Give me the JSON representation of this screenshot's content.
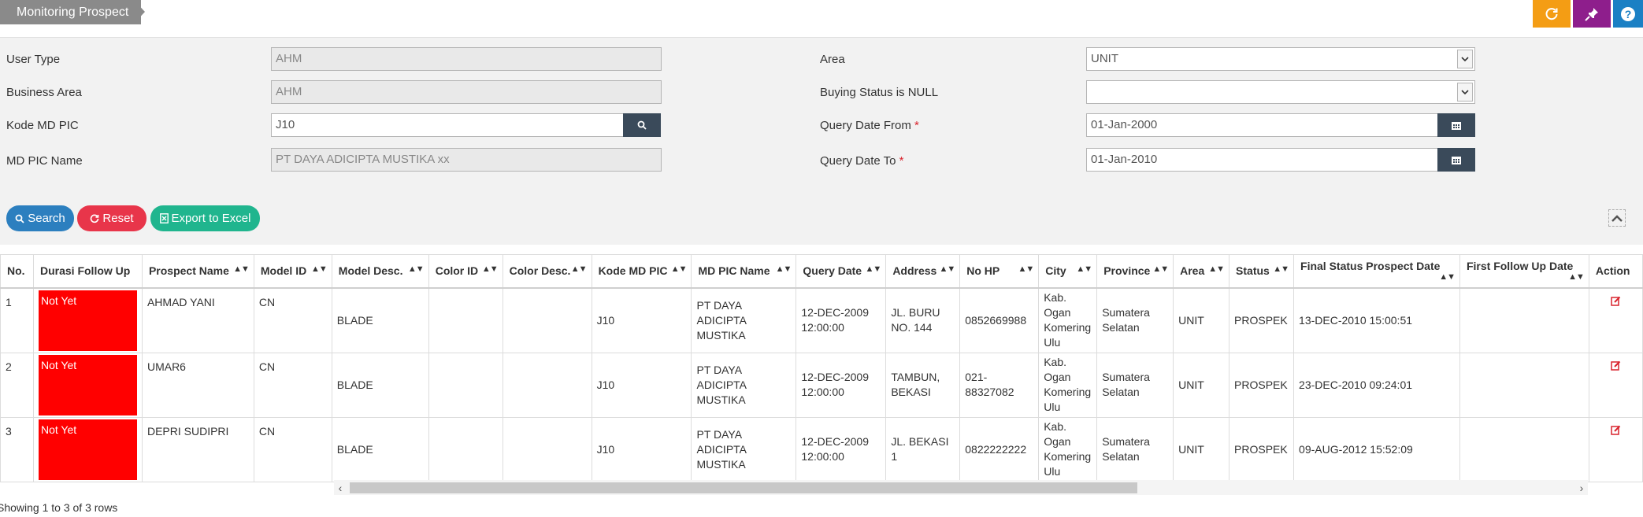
{
  "header": {
    "title": "Monitoring Prospect",
    "icons": [
      "refresh-icon",
      "pin-icon",
      "help-icon"
    ]
  },
  "form": {
    "user_type": {
      "label": "User Type",
      "value": "AHM"
    },
    "business_area": {
      "label": "Business Area",
      "value": "AHM"
    },
    "kode_md_pic": {
      "label": "Kode MD PIC",
      "value": "J10"
    },
    "md_pic_name": {
      "label": "MD PIC Name",
      "value": "PT DAYA ADICIPTA MUSTIKA xx"
    },
    "area": {
      "label": "Area",
      "value": "UNIT"
    },
    "buying_status": {
      "label": "Buying Status is NULL",
      "value": ""
    },
    "query_date_from": {
      "label": "Query Date From",
      "value": "01-Jan-2000"
    },
    "query_date_to": {
      "label": "Query Date To",
      "value": "01-Jan-2010"
    },
    "required_mark": "*"
  },
  "actions": {
    "search": "Search",
    "reset": "Reset",
    "export": "Export to Excel"
  },
  "table": {
    "columns": [
      "No.",
      "Durasi Follow Up",
      "Prospect Name",
      "Model ID",
      "Model Desc.",
      "Color ID",
      "Color Desc.",
      "Kode MD PIC",
      "MD PIC Name",
      "Query Date",
      "Address",
      "No HP",
      "City",
      "Province",
      "Area",
      "Status",
      "Final Status Prospect Date",
      "First Follow Up Date",
      "Action"
    ],
    "rows": [
      {
        "no": "1",
        "durasi": "Not Yet",
        "prospect": "AHMAD YANI",
        "model_id": "CN",
        "model_desc": "BLADE",
        "color_id": "",
        "color_desc": "",
        "kode": "J10",
        "pic_name": "PT DAYA ADICIPTA MUSTIKA",
        "query_date": "12-DEC-2009 12:00:00",
        "address": "JL. BURU NO. 144",
        "no_hp": "0852669988",
        "city": "Kab. Ogan Komering Ulu",
        "province": "Sumatera Selatan",
        "area": "UNIT",
        "status": "PROSPEK",
        "final_date": "13-DEC-2010 15:00:51",
        "first_date": ""
      },
      {
        "no": "2",
        "durasi": "Not Yet",
        "prospect": "UMAR6",
        "model_id": "CN",
        "model_desc": "BLADE",
        "color_id": "",
        "color_desc": "",
        "kode": "J10",
        "pic_name": "PT DAYA ADICIPTA MUSTIKA",
        "query_date": "12-DEC-2009 12:00:00",
        "address": "TAMBUN, BEKASI",
        "no_hp": "021-88327082",
        "city": "Kab. Ogan Komering Ulu",
        "province": "Sumatera Selatan",
        "area": "UNIT",
        "status": "PROSPEK",
        "final_date": "23-DEC-2010 09:24:01",
        "first_date": ""
      },
      {
        "no": "3",
        "durasi": "Not Yet",
        "prospect": "DEPRI SUDIPRI",
        "model_id": "CN",
        "model_desc": "BLADE",
        "color_id": "",
        "color_desc": "",
        "kode": "J10",
        "pic_name": "PT DAYA ADICIPTA MUSTIKA",
        "query_date": "12-DEC-2009 12:00:00",
        "address": "JL. BEKASI 1",
        "no_hp": "0822222222",
        "city": "Kab. Ogan Komering Ulu",
        "province": "Sumatera Selatan",
        "area": "UNIT",
        "status": "PROSPEK",
        "final_date": "09-AUG-2012 15:52:09",
        "first_date": ""
      }
    ]
  },
  "pagination": "Showing 1 to 3 of 3 rows"
}
